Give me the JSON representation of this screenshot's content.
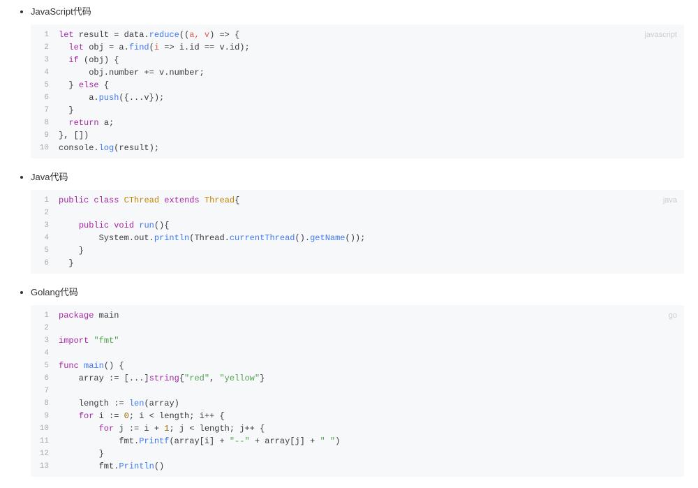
{
  "sections": [
    {
      "title": "JavaScript代码",
      "lang": "javascript",
      "lines": [
        [
          [
            "kw",
            "let"
          ],
          [
            "",
            " result = data."
          ],
          [
            "fn",
            "reduce"
          ],
          [
            "",
            "("
          ],
          [
            "",
            "("
          ],
          [
            "red",
            "a, v"
          ],
          [
            "",
            ") => {"
          ]
        ],
        [
          [
            "",
            "  "
          ],
          [
            "kw",
            "let"
          ],
          [
            "",
            " obj = a."
          ],
          [
            "fn",
            "find"
          ],
          [
            "",
            "("
          ],
          [
            "red",
            "i"
          ],
          [
            "",
            " => i.id == v.id);"
          ]
        ],
        [
          [
            "",
            "  "
          ],
          [
            "kw",
            "if"
          ],
          [
            "",
            " (obj) {"
          ]
        ],
        [
          [
            "",
            "      obj.number += v.number;"
          ]
        ],
        [
          [
            "",
            "  } "
          ],
          [
            "kw",
            "else"
          ],
          [
            "",
            " {"
          ]
        ],
        [
          [
            "",
            "      a."
          ],
          [
            "fn",
            "push"
          ],
          [
            "",
            "({...v});"
          ]
        ],
        [
          [
            "",
            "  }"
          ]
        ],
        [
          [
            "",
            "  "
          ],
          [
            "kw",
            "return"
          ],
          [
            "",
            " a;"
          ]
        ],
        [
          [
            "",
            "}, [])"
          ]
        ],
        [
          [
            "",
            "console."
          ],
          [
            "fn",
            "log"
          ],
          [
            "",
            "(result);"
          ]
        ]
      ]
    },
    {
      "title": "Java代码",
      "lang": "java",
      "lines": [
        [
          [
            "kw",
            "public"
          ],
          [
            "",
            " "
          ],
          [
            "kw",
            "class"
          ],
          [
            "",
            " "
          ],
          [
            "cls",
            "CThread"
          ],
          [
            "",
            " "
          ],
          [
            "kw",
            "extends"
          ],
          [
            "",
            " "
          ],
          [
            "cls",
            "Thread"
          ],
          [
            "",
            "{"
          ]
        ],
        [
          [
            "",
            ""
          ]
        ],
        [
          [
            "",
            "    "
          ],
          [
            "kw",
            "public"
          ],
          [
            "",
            " "
          ],
          [
            "kw",
            "void"
          ],
          [
            "",
            " "
          ],
          [
            "fn",
            "run"
          ],
          [
            "",
            "(){"
          ]
        ],
        [
          [
            "",
            "        System.out."
          ],
          [
            "fn",
            "println"
          ],
          [
            "",
            "(Thread."
          ],
          [
            "fn",
            "currentThread"
          ],
          [
            "",
            "()."
          ],
          [
            "fn",
            "getName"
          ],
          [
            "",
            "());"
          ]
        ],
        [
          [
            "",
            "    }"
          ]
        ],
        [
          [
            "",
            "  }"
          ]
        ]
      ]
    },
    {
      "title": "Golang代码",
      "lang": "go",
      "lines": [
        [
          [
            "kw",
            "package"
          ],
          [
            "",
            " main"
          ]
        ],
        [
          [
            "",
            ""
          ]
        ],
        [
          [
            "kw",
            "import"
          ],
          [
            "",
            " "
          ],
          [
            "str",
            "\"fmt\""
          ]
        ],
        [
          [
            "",
            ""
          ]
        ],
        [
          [
            "kw",
            "func"
          ],
          [
            "",
            " "
          ],
          [
            "fn",
            "main"
          ],
          [
            "",
            "() {"
          ]
        ],
        [
          [
            "",
            "    array := [...]"
          ],
          [
            "kw",
            "string"
          ],
          [
            "",
            "{"
          ],
          [
            "str",
            "\"red\""
          ],
          [
            "",
            ", "
          ],
          [
            "str",
            "\"yellow\""
          ],
          [
            "",
            "}"
          ]
        ],
        [
          [
            "",
            ""
          ]
        ],
        [
          [
            "",
            "    length := "
          ],
          [
            "fn",
            "len"
          ],
          [
            "",
            "(array)"
          ]
        ],
        [
          [
            "",
            "    "
          ],
          [
            "kw",
            "for"
          ],
          [
            "",
            " i := "
          ],
          [
            "num",
            "0"
          ],
          [
            "",
            "; i < length; i++ {"
          ]
        ],
        [
          [
            "",
            "        "
          ],
          [
            "kw",
            "for"
          ],
          [
            "",
            " j := i + "
          ],
          [
            "num",
            "1"
          ],
          [
            "",
            "; j < length; j++ {"
          ]
        ],
        [
          [
            "",
            "            fmt."
          ],
          [
            "fn",
            "Printf"
          ],
          [
            "",
            "(array[i] + "
          ],
          [
            "str",
            "\"--\""
          ],
          [
            "",
            " + array[j] + "
          ],
          [
            "str",
            "\" \""
          ],
          [
            "",
            ")"
          ]
        ],
        [
          [
            "",
            "        }"
          ]
        ],
        [
          [
            "",
            "        fmt."
          ],
          [
            "fn",
            "Println"
          ],
          [
            "",
            "()"
          ]
        ]
      ]
    }
  ]
}
